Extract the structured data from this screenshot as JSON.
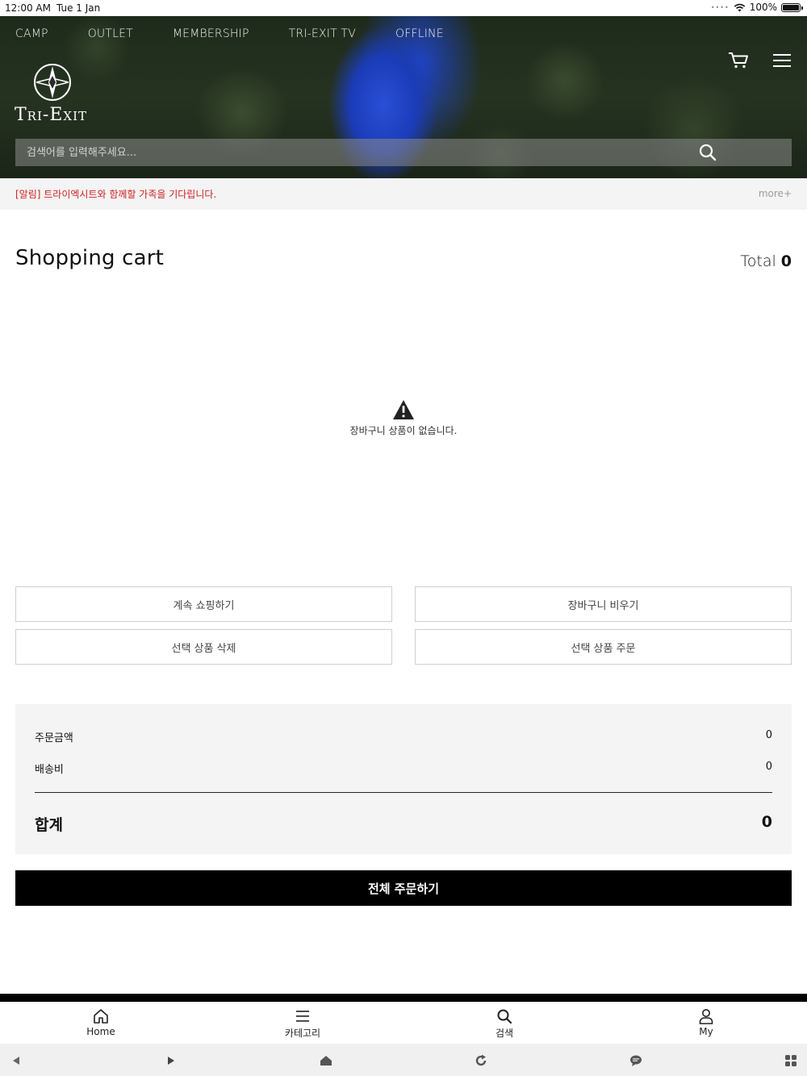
{
  "status_bar": {
    "time": "12:00 AM",
    "date": "Tue 1 Jan",
    "battery": "100%"
  },
  "nav": {
    "items": [
      "CAMP",
      "OUTLET",
      "MEMBERSHIP",
      "TRI-EXIT TV",
      "OFFLINE"
    ]
  },
  "logo": {
    "text": "Tri-Exit"
  },
  "search": {
    "placeholder": "검색어를 입력해주세요..."
  },
  "notice": {
    "text": "[알림] 트라이엑시트와 함께할 가족을 기다립니다.",
    "more": "more+"
  },
  "cart": {
    "title": "Shopping cart",
    "total_label": "Total",
    "total_count": "0",
    "empty_message": "장바구니 상품이 없습니다."
  },
  "buttons": {
    "continue_shopping": "계속 쇼핑하기",
    "empty_cart": "장바구니 비우기",
    "delete_selected": "선택 상품 삭제",
    "order_selected": "선택 상품 주문",
    "order_all": "전체 주문하기"
  },
  "summary": {
    "order_amount_label": "주문금액",
    "order_amount": "0",
    "shipping_label": "배송비",
    "shipping": "0",
    "total_label": "합계",
    "total": "0"
  },
  "tabbar": {
    "home": "Home",
    "category": "카테고리",
    "search": "검색",
    "my": "My"
  },
  "colors": {
    "notice_red": "#d02020",
    "order_button": "#000000"
  },
  "icons": [
    "wifi-icon",
    "battery-icon",
    "cart-icon",
    "menu-icon",
    "compass-logo-icon",
    "search-icon",
    "warning-icon",
    "home-icon",
    "category-menu-icon",
    "search-tab-icon",
    "user-icon",
    "back-icon",
    "forward-icon",
    "browser-home-icon",
    "refresh-icon",
    "chat-icon",
    "apps-icon"
  ]
}
